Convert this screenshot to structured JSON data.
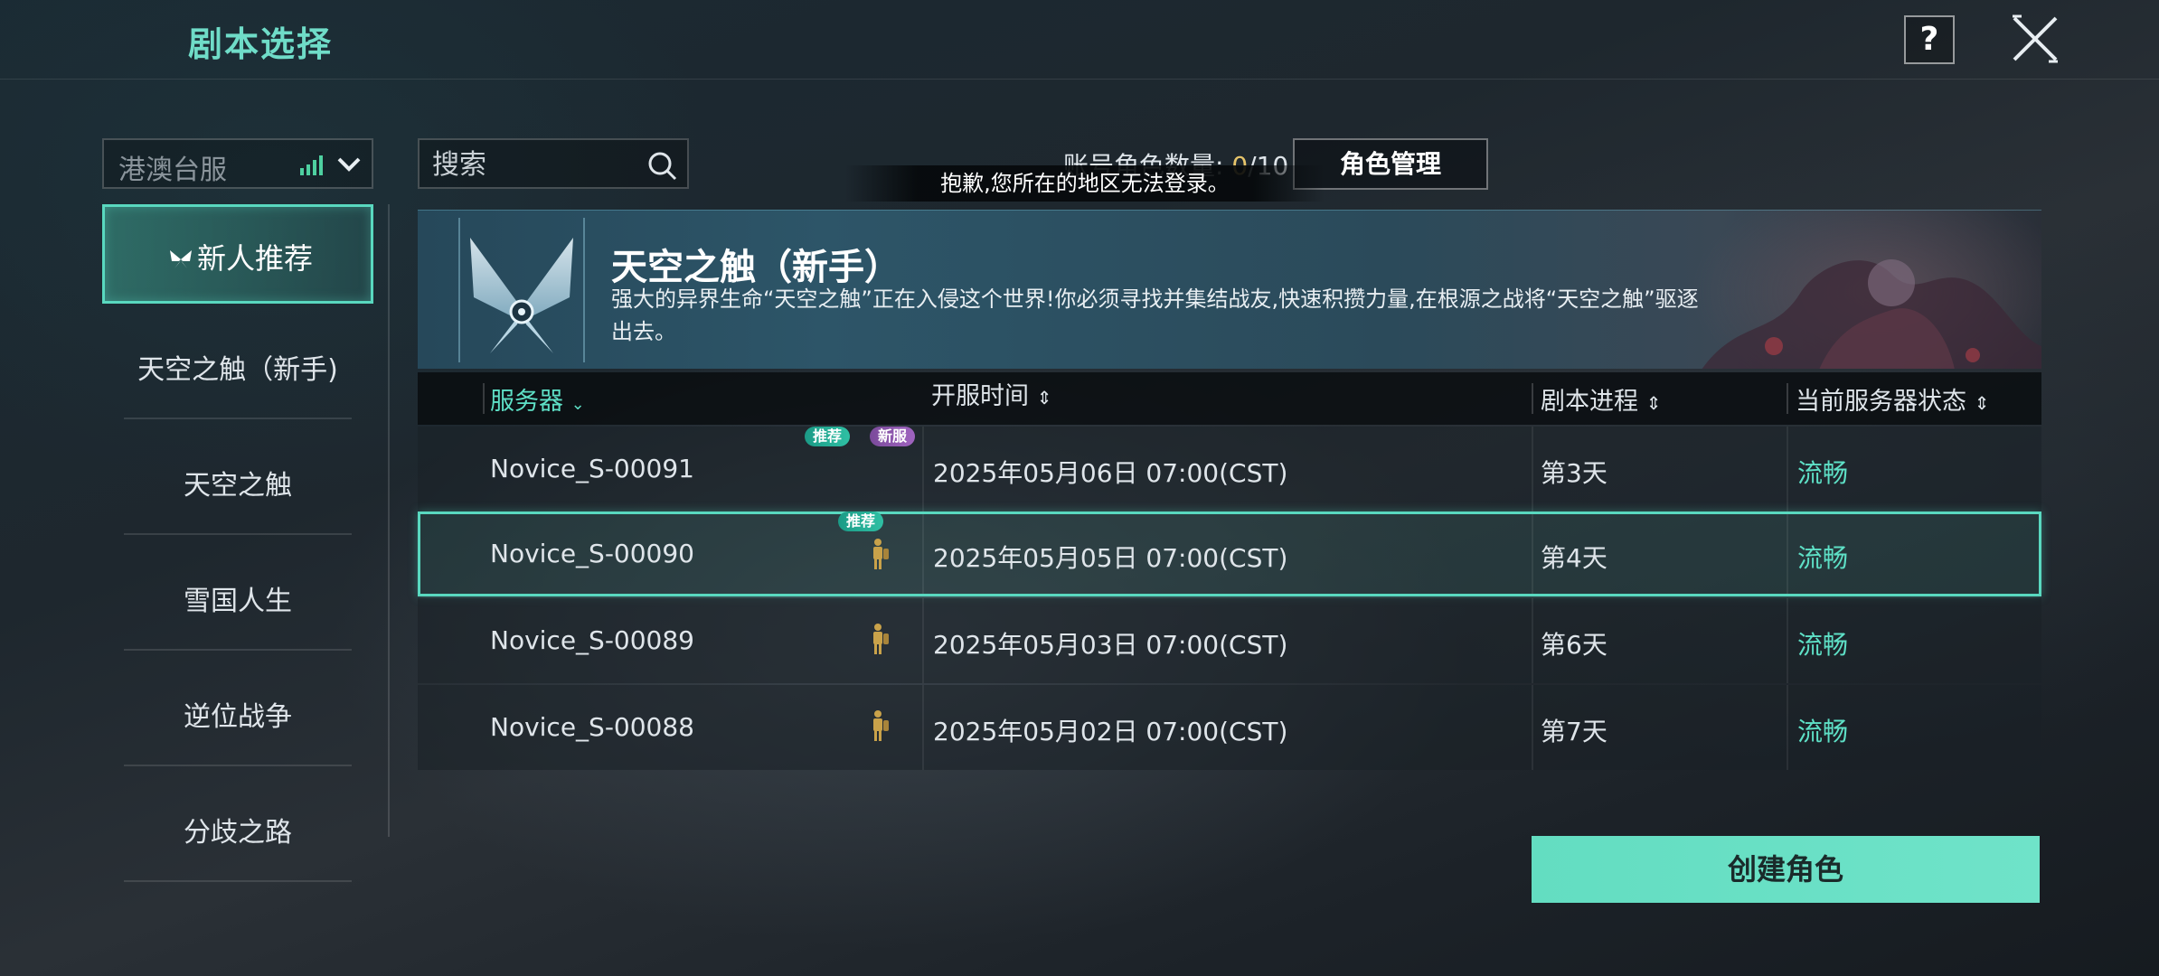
{
  "header": {
    "title": "剧本选择",
    "help_label": "?"
  },
  "region": {
    "selected": "港澳台服"
  },
  "sidebar": {
    "items": [
      {
        "label": "新人推荐",
        "active": true
      },
      {
        "label": "天空之触（新手)"
      },
      {
        "label": "天空之触"
      },
      {
        "label": "雪国人生"
      },
      {
        "label": "逆位战争"
      },
      {
        "label": "分歧之路"
      }
    ]
  },
  "search": {
    "placeholder": "搜索"
  },
  "account": {
    "label": "账号角色数量:",
    "current": "0",
    "max": "/10",
    "manage_label": "角色管理"
  },
  "toast": "抱歉,您所在的地区无法登录。",
  "banner": {
    "title": "天空之触（新手）",
    "description": "强大的异界生命“天空之触”正在入侵这个世界!你必须寻找并集结战友,快速积攒力量,在根源之战将“天空之触”驱逐出去。"
  },
  "table": {
    "columns": [
      "服务器",
      "开服时间",
      "剧本进程",
      "当前服务器状态"
    ],
    "rows": [
      {
        "server": "Novice_S-00091",
        "open_time": "2025年05月06日 07:00(CST)",
        "progress": "第3天",
        "status": "流畅",
        "badges": [
          "推荐",
          "新服"
        ]
      },
      {
        "server": "Novice_S-00090",
        "open_time": "2025年05月05日 07:00(CST)",
        "progress": "第4天",
        "status": "流畅",
        "badges": [
          "推荐"
        ]
      },
      {
        "server": "Novice_S-00089",
        "open_time": "2025年05月03日 07:00(CST)",
        "progress": "第6天",
        "status": "流畅",
        "badges": []
      },
      {
        "server": "Novice_S-00088",
        "open_time": "2025年05月02日 07:00(CST)",
        "progress": "第7天",
        "status": "流畅",
        "badges": []
      }
    ]
  },
  "create_button": "创建角色",
  "colors": {
    "accent": "#59d8bf",
    "gold": "#e6c46a"
  }
}
